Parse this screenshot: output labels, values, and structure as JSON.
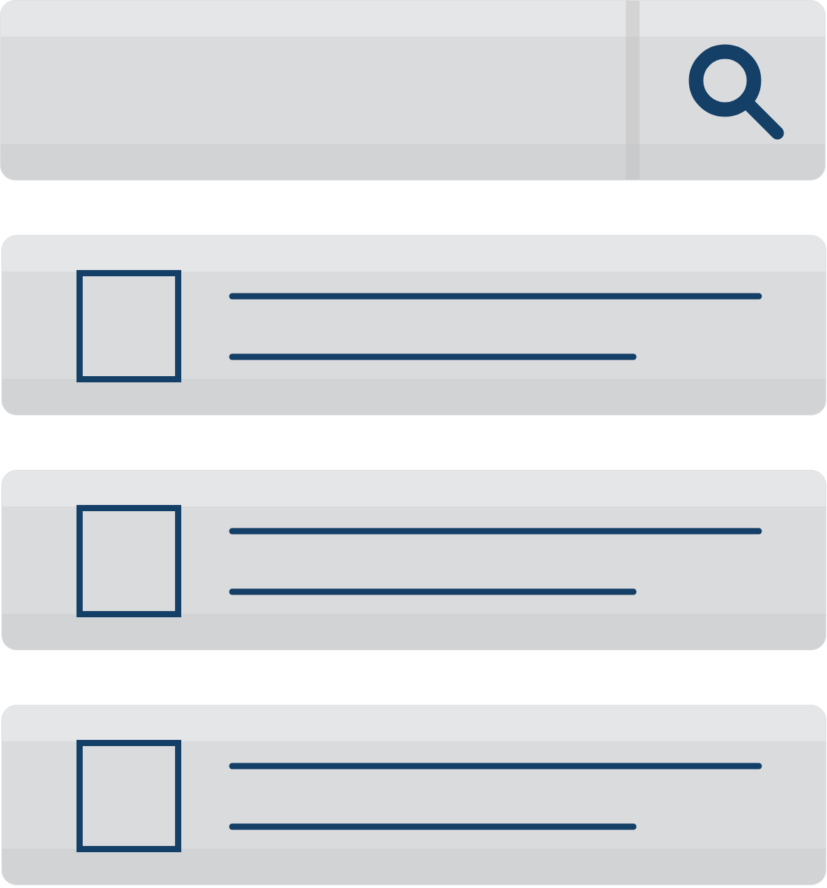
{
  "search_bar": {
    "kind": "search"
  },
  "results": [
    {
      "kind": "placeholder"
    },
    {
      "kind": "placeholder"
    },
    {
      "kind": "placeholder"
    }
  ]
}
